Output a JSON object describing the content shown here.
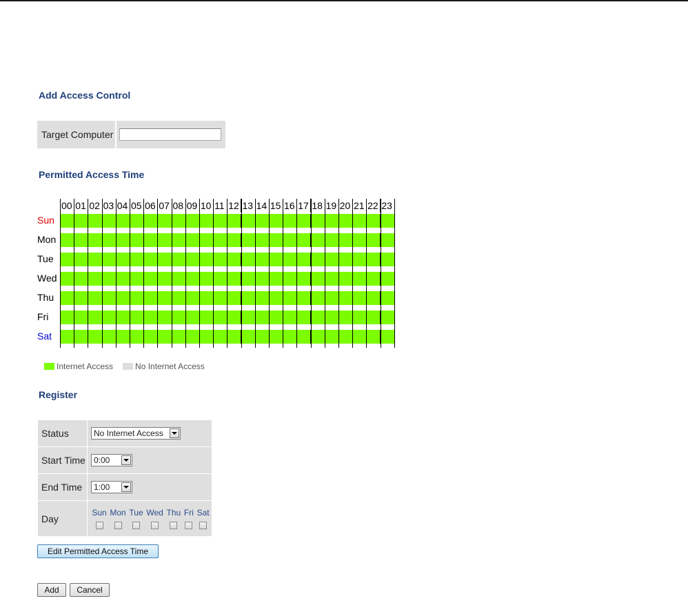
{
  "page": {
    "title": "Add Access Control"
  },
  "target": {
    "label": "Target Computer",
    "value": ""
  },
  "schedule": {
    "title": "Permitted Access Time",
    "hours": [
      "00",
      "01",
      "02",
      "03",
      "04",
      "05",
      "06",
      "07",
      "08",
      "09",
      "10",
      "11",
      "12",
      "13",
      "14",
      "15",
      "16",
      "17",
      "18",
      "19",
      "20",
      "21",
      "22",
      "23"
    ],
    "days": [
      "Sun",
      "Mon",
      "Tue",
      "Wed",
      "Thu",
      "Fri",
      "Sat"
    ],
    "access": {
      "Sun": "all",
      "Mon": "all",
      "Tue": "all",
      "Wed": "all",
      "Thu": "all",
      "Fri": "all",
      "Sat": "all"
    },
    "colors": {
      "access": "#7cfc00",
      "no_access": "#dddddd",
      "sunday": "#e00000",
      "saturday": "#0000d0"
    }
  },
  "legend": {
    "internet_access": "Internet Access",
    "no_internet_access": "No Internet Access"
  },
  "register": {
    "title": "Register",
    "status_label": "Status",
    "status_value": "No Internet Access",
    "start_label": "Start Time",
    "start_value": "0:00",
    "end_label": "End Time",
    "end_value": "1:00",
    "day_label": "Day",
    "days": [
      "Sun",
      "Mon",
      "Tue",
      "Wed",
      "Thu",
      "Fri",
      "Sat"
    ]
  },
  "buttons": {
    "edit": "Edit Permitted Access Time",
    "add": "Add",
    "cancel": "Cancel"
  }
}
